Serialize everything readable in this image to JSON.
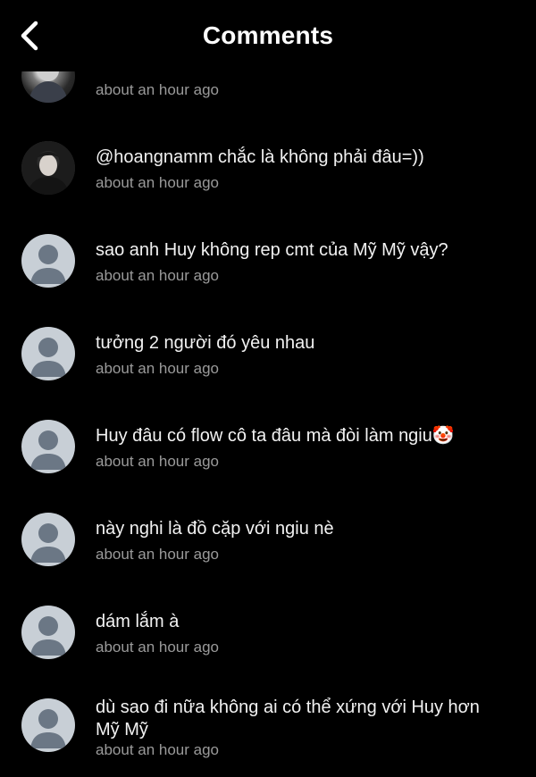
{
  "header": {
    "title": "Comments",
    "back_icon": "chevron-left-icon"
  },
  "comments": [
    {
      "text": "",
      "time": "about an hour ago",
      "avatar": "photo"
    },
    {
      "text": "@hoangnamm chắc là không phải đâu=))",
      "time": "about an hour ago",
      "avatar": "photo"
    },
    {
      "text": "sao anh Huy không rep cmt của Mỹ Mỹ vậy?",
      "time": "about an hour ago",
      "avatar": "default"
    },
    {
      "text": "tưởng 2 người đó yêu nhau",
      "time": "about an hour ago",
      "avatar": "default"
    },
    {
      "text": "Huy đâu có flow cô ta đâu mà đòi làm ngiu🤡",
      "time": "about an hour ago",
      "avatar": "default"
    },
    {
      "text": "này nghi là đồ cặp với ngiu nè",
      "time": "about an hour ago",
      "avatar": "default"
    },
    {
      "text": "dám lắm à",
      "time": "about an hour ago",
      "avatar": "default"
    },
    {
      "text": "dù sao đi nữa không ai có thể xứng với Huy hơn Mỹ Mỹ",
      "time": "about an hour ago",
      "avatar": "default"
    }
  ]
}
